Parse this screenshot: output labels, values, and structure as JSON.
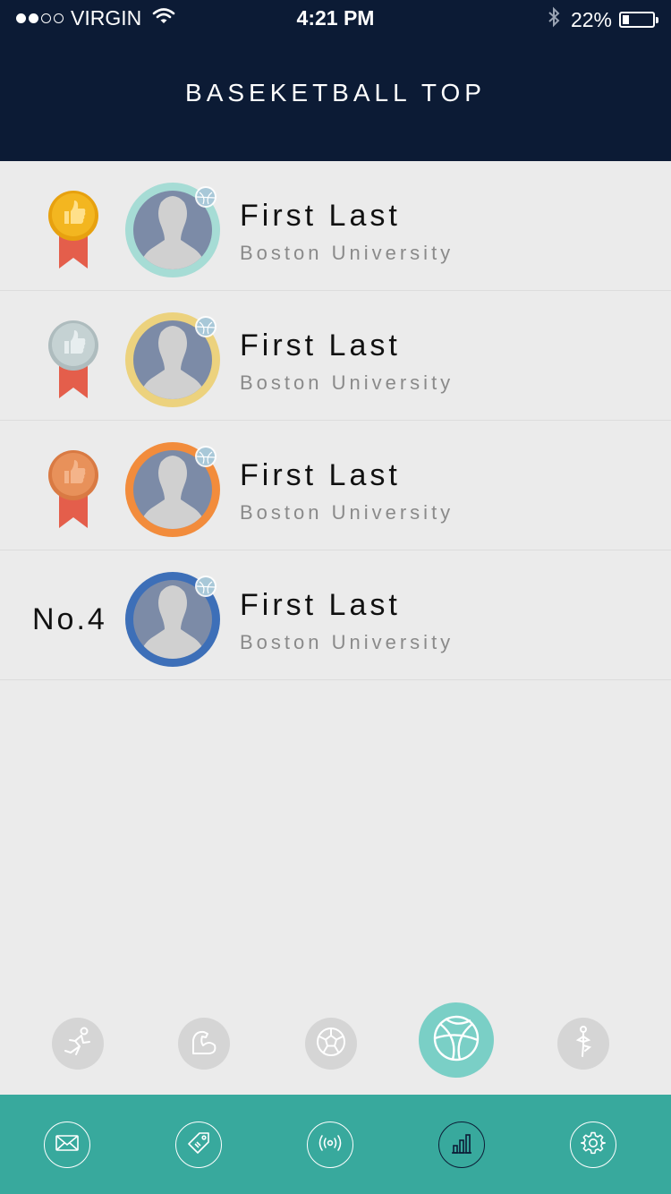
{
  "status_bar": {
    "carrier": "VIRGIN",
    "time": "4:21 PM",
    "battery": "22%",
    "battery_level": 0.22,
    "signal_bars_filled": 2,
    "signal_bars_total": 4
  },
  "header": {
    "title": "BASEKETBALL TOP"
  },
  "leaderboard": [
    {
      "rank": 1,
      "rank_label": "",
      "medal": "gold",
      "ring_color": "#a6dcd5",
      "name": "First Last",
      "school": "Boston University"
    },
    {
      "rank": 2,
      "rank_label": "",
      "medal": "silver",
      "ring_color": "#ecd27e",
      "name": "First Last",
      "school": "Boston University"
    },
    {
      "rank": 3,
      "rank_label": "",
      "medal": "bronze",
      "ring_color": "#f28c3c",
      "name": "First Last",
      "school": "Boston University"
    },
    {
      "rank": 4,
      "rank_label": "No.4",
      "medal": "",
      "ring_color": "#3d6fb8",
      "name": "First Last",
      "school": "Boston University"
    }
  ],
  "sports": [
    {
      "icon": "running-icon",
      "active": false
    },
    {
      "icon": "muscle-icon",
      "active": false
    },
    {
      "icon": "soccer-ball-icon",
      "active": false
    },
    {
      "icon": "basketball-icon",
      "active": true
    },
    {
      "icon": "yoga-icon",
      "active": false
    }
  ],
  "tabs": [
    {
      "icon": "mail-icon",
      "active": false
    },
    {
      "icon": "tag-icon",
      "active": false
    },
    {
      "icon": "broadcast-icon",
      "active": false
    },
    {
      "icon": "bar-chart-icon",
      "active": true
    },
    {
      "icon": "gear-icon",
      "active": false
    }
  ],
  "colors": {
    "header_bg": "#0c1b35",
    "accent_teal": "#38a99d",
    "active_sport": "#7acfc6",
    "gold": "#f3b620",
    "silver": "#c5d2d3",
    "bronze": "#e8915a",
    "ribbon": "#e45e4b"
  }
}
